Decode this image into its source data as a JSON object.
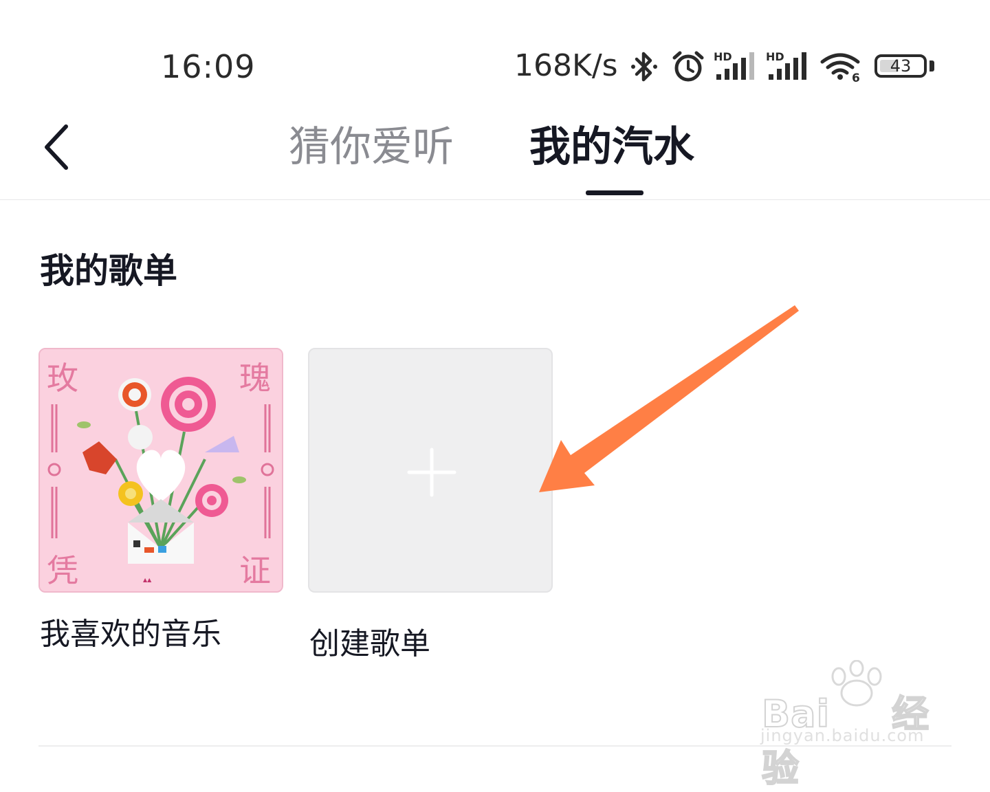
{
  "status_bar": {
    "time": "16:09",
    "network_speed": "168K/s",
    "battery_level": "43",
    "battery_fraction": 0.43,
    "hd_label": "HD",
    "wifi_label": "6",
    "icons": [
      "bluetooth-icon",
      "alarm-icon",
      "signal-hd-icon",
      "signal-hd-icon",
      "wifi-6-icon",
      "battery-icon"
    ]
  },
  "nav": {
    "back_icon": "chevron-left-icon",
    "tabs": [
      {
        "label": "猜你爱听",
        "active": false
      },
      {
        "label": "我的汽水",
        "active": true
      }
    ]
  },
  "playlists": {
    "section_title": "我的歌单",
    "items": [
      {
        "label": "我喜欢的音乐",
        "cover": "rose-bouquet-cover",
        "cover_text": [
          "玫",
          "瑰",
          "凭",
          "证"
        ]
      },
      {
        "label": "创建歌单",
        "icon": "plus-icon"
      }
    ]
  },
  "annotation": {
    "color": "#ff7f45",
    "icon": "arrow-icon"
  },
  "watermark": {
    "brand": "Bai",
    "brand_suffix": "经验",
    "site": "jingyan.baidu.com"
  },
  "colors": {
    "text_primary": "#161823",
    "text_secondary": "#8a8b91",
    "cover_pink": "#fbd1df",
    "create_card": "#efeff0"
  }
}
